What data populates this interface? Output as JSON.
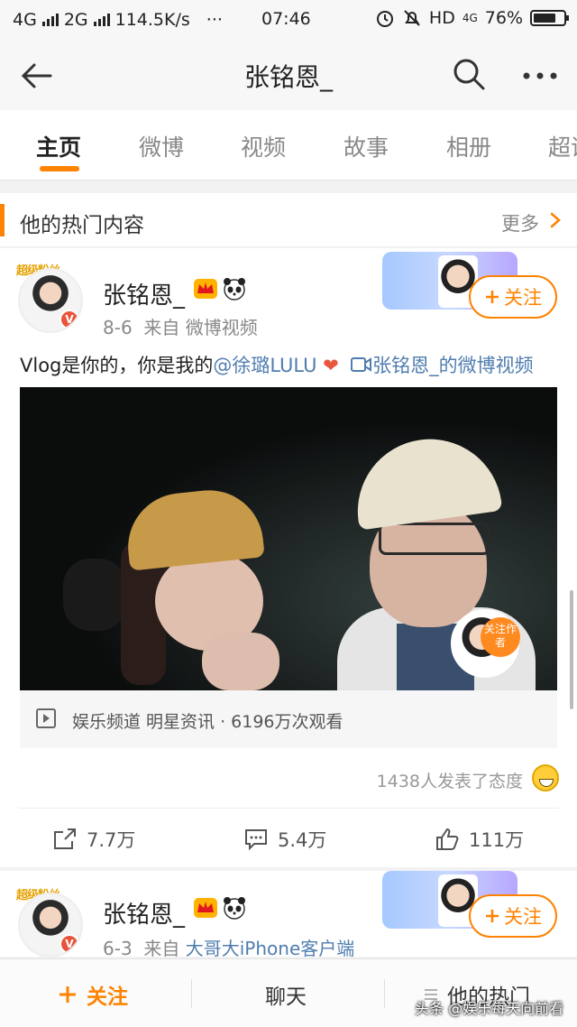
{
  "status": {
    "net1": "4G",
    "net2": "2G",
    "speed": "114.5K/s",
    "dots": "···",
    "time": "07:46",
    "hd": "HD",
    "net3": "4G",
    "battery": "76%",
    "battery_level": 0.76
  },
  "nav": {
    "title": "张铭恩_"
  },
  "tabs": [
    {
      "label": "主页",
      "active": true
    },
    {
      "label": "微博"
    },
    {
      "label": "视频"
    },
    {
      "label": "故事"
    },
    {
      "label": "相册"
    },
    {
      "label": "超话"
    }
  ],
  "section": {
    "title": "他的热门内容",
    "more": "更多"
  },
  "post1": {
    "crown_text": "超级粉丝",
    "name": "张铭恩_",
    "date": "8-6",
    "from": "来自",
    "source": "微博视频",
    "follow": "关注",
    "text_plain": "Vlog是你的，你是我的",
    "mention": "@徐璐LULU",
    "heart": "❤",
    "video_link": "张铭恩_的微博视频",
    "follow_author_tag": "关注作者",
    "video_info": "娱乐频道 明星资讯 · 6196万次观看",
    "reaction": "1438人发表了态度",
    "repost": "7.7万",
    "comment": "5.4万",
    "like": "111万"
  },
  "post2": {
    "crown_text": "超级粉丝",
    "name": "张铭恩_",
    "date": "6-3",
    "from": "来自",
    "source": "大哥大iPhone客户端",
    "follow": "关注"
  },
  "bottom": {
    "follow": "关注",
    "chat": "聊天",
    "hot": "他的热门"
  },
  "watermark": "头条 @娱乐每天向前看",
  "colors": {
    "accent": "#ff8200",
    "link": "#507daf"
  }
}
